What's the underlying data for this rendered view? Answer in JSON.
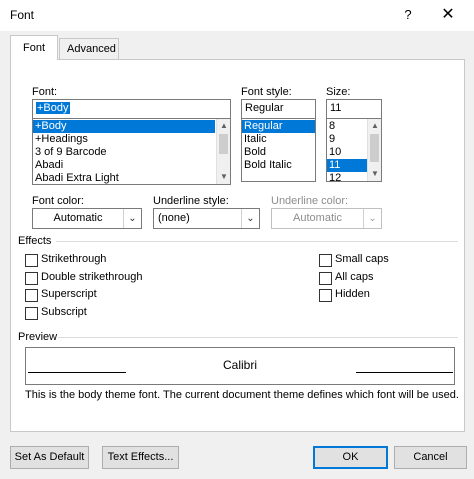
{
  "window": {
    "title": "Font",
    "help": "?",
    "close": "✕"
  },
  "tabs": [
    {
      "label": "Font"
    },
    {
      "label": "Advanced"
    }
  ],
  "font": {
    "label": "Font:",
    "value": "+Body",
    "items": [
      "+Body",
      "+Headings",
      "3 of 9 Barcode",
      "Abadi",
      "Abadi Extra Light"
    ],
    "selected_index": 0
  },
  "style": {
    "label": "Font style:",
    "value": "Regular",
    "items": [
      "Regular",
      "Italic",
      "Bold",
      "Bold Italic"
    ],
    "selected_index": 0
  },
  "size": {
    "label": "Size:",
    "value": "11",
    "items": [
      "8",
      "9",
      "10",
      "11",
      "12"
    ],
    "selected_index": 3
  },
  "font_color": {
    "label": "Font color:",
    "value": "Automatic"
  },
  "underline_style": {
    "label": "Underline style:",
    "value": "(none)"
  },
  "underline_color": {
    "label": "Underline color:",
    "value": "Automatic"
  },
  "effects": {
    "title": "Effects",
    "left": [
      "Strikethrough",
      "Double strikethrough",
      "Superscript",
      "Subscript"
    ],
    "right": [
      "Small caps",
      "All caps",
      "Hidden"
    ]
  },
  "preview": {
    "title": "Preview",
    "sample": "Calibri",
    "description": "This is the body theme font. The current document theme defines which font will be used."
  },
  "buttons": {
    "set_default": "Set As Default",
    "text_effects": "Text Effects...",
    "ok": "OK",
    "cancel": "Cancel"
  },
  "colors": {
    "selection": "#0078d7",
    "ok_border": "#0078d7"
  }
}
